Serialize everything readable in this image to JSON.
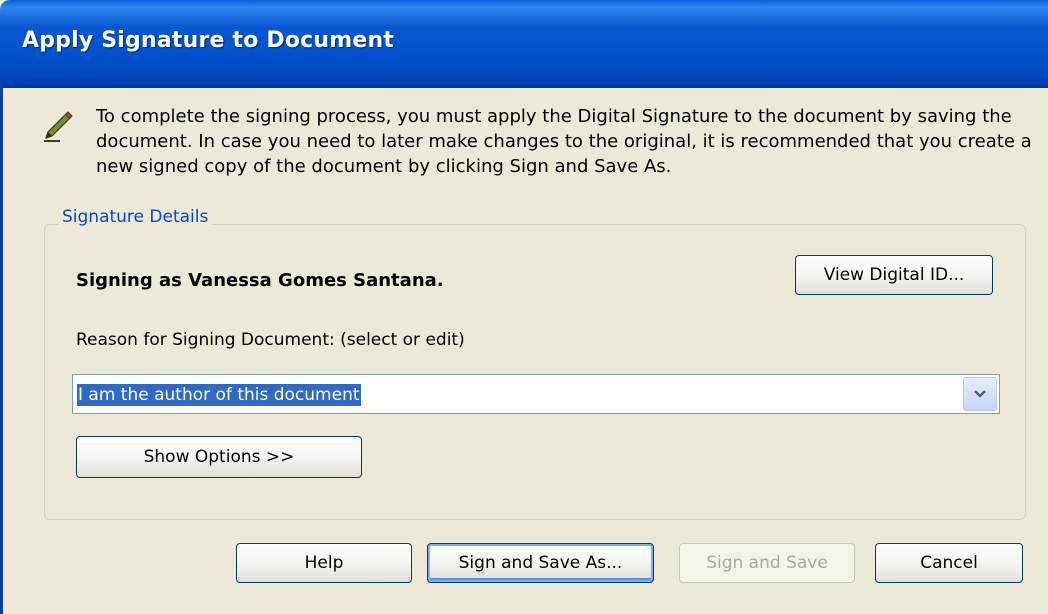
{
  "dialog": {
    "title": "Apply Signature to Document",
    "intro_text": "To complete the signing process, you must apply the Digital Signature to the document by saving the document. In case you need to later make changes to the original, it is recommended that you create a new signed copy of the document by clicking Sign and Save As."
  },
  "signature_details": {
    "legend": "Signature Details",
    "signing_as": "Signing as Vanessa Gomes Santana.",
    "view_digital_id_label": "View Digital ID...",
    "reason_label": "Reason for Signing Document: (select or edit)",
    "reason_value": "I am the author of this document",
    "show_options_label": "Show Options >>"
  },
  "footer": {
    "help_label": "Help",
    "sign_save_as_label": "Sign and Save As...",
    "sign_save_label": "Sign and Save",
    "cancel_label": "Cancel"
  },
  "colors": {
    "titlebar": "#0053cc",
    "dialog_bg": "#ece9d8",
    "legend_text": "#0046d5",
    "selection": "#316ac5"
  }
}
